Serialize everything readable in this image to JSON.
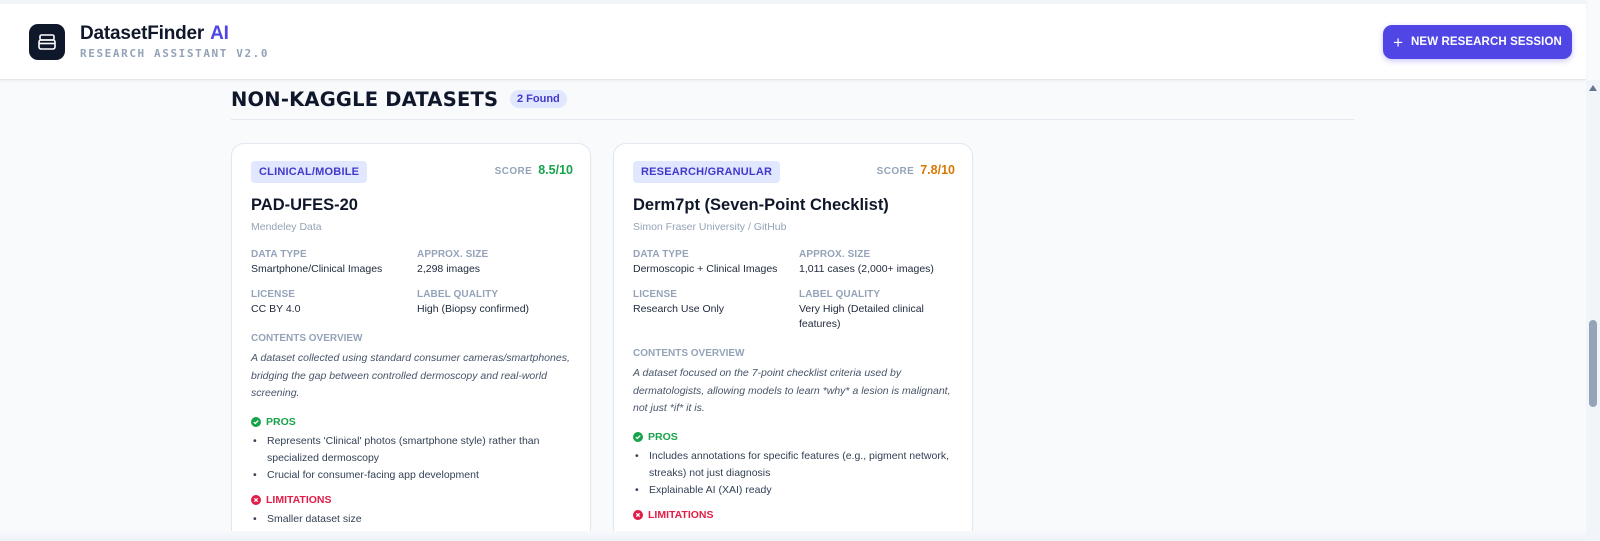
{
  "app": {
    "name": "DatasetFinder",
    "name_suffix": "AI",
    "subtitle": "RESEARCH ASSISTANT V2.0",
    "logo_icon": "archive-box-icon",
    "brand_color": "#4f46e5"
  },
  "header": {
    "new_session_label": "NEW RESEARCH SESSION",
    "new_session_icon": "plus-icon"
  },
  "section": {
    "title": "NON-KAGGLE DATASETS",
    "count_badge": "2 Found"
  },
  "labels": {
    "score": "SCORE",
    "data_type": "DATA TYPE",
    "approx_size": "APPROX. SIZE",
    "license": "LICENSE",
    "label_quality": "LABEL QUALITY",
    "contents_overview": "CONTENTS OVERVIEW",
    "pros": "PROS",
    "limitations": "LIMITATIONS"
  },
  "datasets": [
    {
      "tag": "CLINICAL/MOBILE",
      "score": "8.5/10",
      "score_color": "#16a34a",
      "title": "PAD-UFES-20",
      "source": "Mendeley Data",
      "data_type": "Smartphone/Clinical Images",
      "approx_size": "2,298 images",
      "license": "CC BY 4.0",
      "label_quality": "High (Biopsy confirmed)",
      "overview": "A dataset collected using standard consumer cameras/smartphones, bridging the gap between controlled dermoscopy and real-world screening.",
      "pros": [
        "Represents 'Clinical' photos (smartphone style) rather than specialized dermoscopy",
        "Crucial for consumer-facing app development"
      ],
      "limitations": [
        "Smaller dataset size"
      ]
    },
    {
      "tag": "RESEARCH/GRANULAR",
      "score": "7.8/10",
      "score_color": "#d97706",
      "title": "Derm7pt (Seven-Point Checklist)",
      "source": "Simon Fraser University / GitHub",
      "data_type": "Dermoscopic + Clinical Images",
      "approx_size": "1,011 cases (2,000+ images)",
      "license": "Research Use Only",
      "label_quality": "Very High (Detailed clinical features)",
      "overview": "A dataset focused on the 7-point checklist criteria used by dermatologists, allowing models to learn *why* a lesion is malignant, not just *if* it is.",
      "pros": [
        "Includes annotations for specific features (e.g., pigment network, streaks) not just diagnosis",
        "Explainable AI (XAI) ready"
      ],
      "limitations": []
    }
  ]
}
